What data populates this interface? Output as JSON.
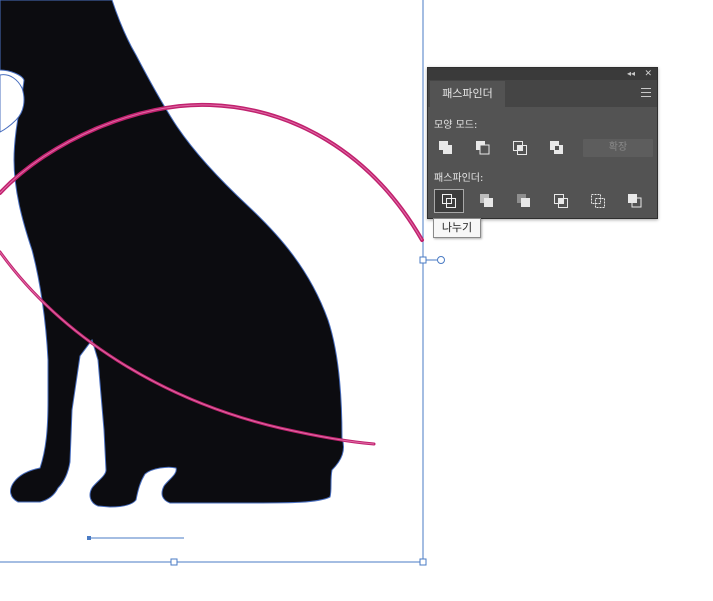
{
  "panel": {
    "title": "패스파인더",
    "shape_modes_label": "모양 모드:",
    "pathfinders_label": "패스파인더:",
    "expand_label": "확장",
    "shape_modes": [
      "unite-icon",
      "minus-front-icon",
      "intersect-icon",
      "exclude-icon"
    ],
    "pathfinders": [
      "divide-icon",
      "trim-icon",
      "merge-icon",
      "crop-icon",
      "outline-icon",
      "minus-back-icon"
    ]
  },
  "tooltip": {
    "text": "나누기"
  },
  "colors": {
    "silhouette": "#0c0c10",
    "arc_stroke": "#c0226e",
    "selection": "#4a7bc4",
    "panel_bg": "#535353"
  }
}
